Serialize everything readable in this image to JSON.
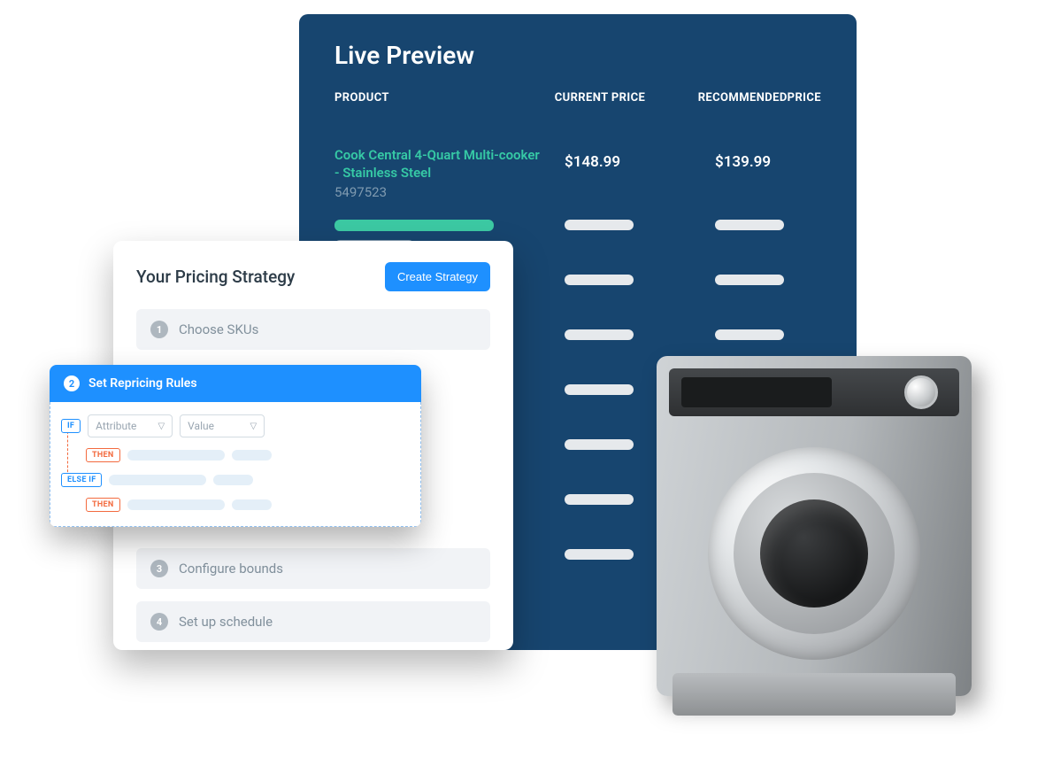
{
  "livePreview": {
    "title": "Live Preview",
    "columns": {
      "product": "PRODUCT",
      "current": "CURRENT PRICE",
      "recommended": "RECOMMENDEDPRICE"
    },
    "product": {
      "name": "Cook Central 4-Quart Multi-cooker - Stainless Steel",
      "sku": "5497523",
      "currentPrice": "$148.99",
      "recommendedPrice": "$139.99"
    }
  },
  "strategy": {
    "title": "Your Pricing Strategy",
    "createLabel": "Create Strategy",
    "steps": {
      "s1": "Choose SKUs",
      "s3": "Configure bounds",
      "s4": "Set up schedule"
    }
  },
  "rules": {
    "title": "Set Repricing Rules",
    "stepNumber": "2",
    "if": "IF",
    "then": "THEN",
    "elseif": "ELSE IF",
    "attributePlaceholder": "Attribute",
    "valuePlaceholder": "Value"
  }
}
